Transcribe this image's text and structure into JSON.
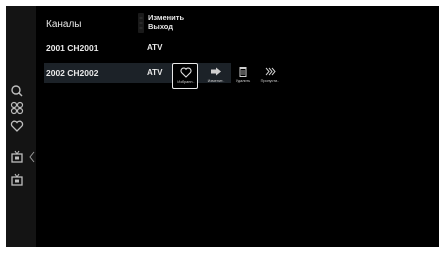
{
  "header": {
    "title": "Каналы",
    "actions": [
      "Изменить",
      "Выход"
    ]
  },
  "channels": [
    {
      "name": "2001 CH2001",
      "type": "ATV",
      "selected": false
    },
    {
      "name": "2002 CH2002",
      "type": "ATV",
      "selected": true
    }
  ],
  "channel_options": [
    {
      "label": "Избранн..",
      "icon": "heart-icon",
      "focused": true
    },
    {
      "label": "Изменит..",
      "icon": "move-icon",
      "focused": false
    },
    {
      "label": "Удалить",
      "icon": "trash-icon",
      "focused": false
    },
    {
      "label": "Пропусти..",
      "icon": "skip-icon",
      "focused": false
    }
  ],
  "sidebar": {
    "items": [
      {
        "icon": "search-icon"
      },
      {
        "icon": "apps-icon"
      },
      {
        "icon": "heart-icon"
      },
      {
        "icon": "tv-icon",
        "active": true
      },
      {
        "icon": "tv-input-icon"
      }
    ]
  },
  "colors": {
    "background": "#000000",
    "sidebar": "#141414",
    "selected_row": "#1c2228",
    "text": "#e6e6e6"
  }
}
